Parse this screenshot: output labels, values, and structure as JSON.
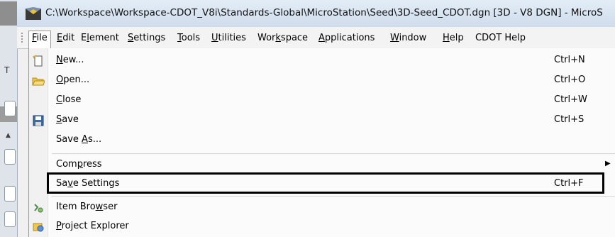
{
  "window": {
    "title": "C:\\Workspace\\Workspace-CDOT_V8i\\Standards-Global\\MicroStation\\Seed\\3D-Seed_CDOT.dgn [3D - V8 DGN] - MicroS"
  },
  "left_strip": {
    "label": "T"
  },
  "menubar": {
    "items": [
      {
        "label": "File",
        "mnemonic": "F",
        "rest": "ile"
      },
      {
        "label": "Edit",
        "mnemonic": "E",
        "rest": "dit"
      },
      {
        "label": "Element",
        "pre": "E",
        "mnemonic": "l",
        "rest": "ement"
      },
      {
        "label": "Settings",
        "mnemonic": "S",
        "rest": "ettings"
      },
      {
        "label": "Tools",
        "mnemonic": "T",
        "rest": "ools"
      },
      {
        "label": "Utilities",
        "mnemonic": "U",
        "rest": "tilities"
      },
      {
        "label": "Workspace",
        "pre": "Wor",
        "mnemonic": "k",
        "rest": "space"
      },
      {
        "label": "Applications",
        "mnemonic": "A",
        "rest": "pplications"
      },
      {
        "label": "Window",
        "mnemonic": "W",
        "rest": "indow"
      },
      {
        "label": "Help",
        "mnemonic": "H",
        "rest": "elp"
      },
      {
        "label": "CDOT Help"
      }
    ]
  },
  "file_menu": {
    "items": [
      {
        "pre": "",
        "mnemonic": "N",
        "rest": "ew...",
        "shortcut": "Ctrl+N",
        "icon": "new-file-icon"
      },
      {
        "pre": "",
        "mnemonic": "O",
        "rest": "pen...",
        "shortcut": "Ctrl+O",
        "icon": "open-folder-icon"
      },
      {
        "pre": "",
        "mnemonic": "C",
        "rest": "lose",
        "shortcut": "Ctrl+W",
        "icon": ""
      },
      {
        "pre": "",
        "mnemonic": "S",
        "rest": "ave",
        "shortcut": "Ctrl+S",
        "icon": "save-disk-icon"
      },
      {
        "pre": "Save ",
        "mnemonic": "A",
        "rest": "s...",
        "shortcut": "",
        "icon": ""
      },
      {
        "pre": "Com",
        "mnemonic": "p",
        "rest": "ress",
        "shortcut": "",
        "icon": "",
        "submenu": true
      },
      {
        "pre": "Sa",
        "mnemonic": "v",
        "rest": "e Settings",
        "shortcut": "Ctrl+F",
        "icon": ""
      },
      {
        "pre": "Item Bro",
        "mnemonic": "w",
        "rest": "ser",
        "shortcut": "",
        "icon": "item-browser-icon"
      },
      {
        "pre": "",
        "mnemonic": "P",
        "rest": "roject Explorer",
        "shortcut": "",
        "icon": "project-explorer-icon"
      }
    ]
  },
  "colors": {
    "highlight_border": "#000000",
    "title_bar": "#dbe6f3"
  }
}
